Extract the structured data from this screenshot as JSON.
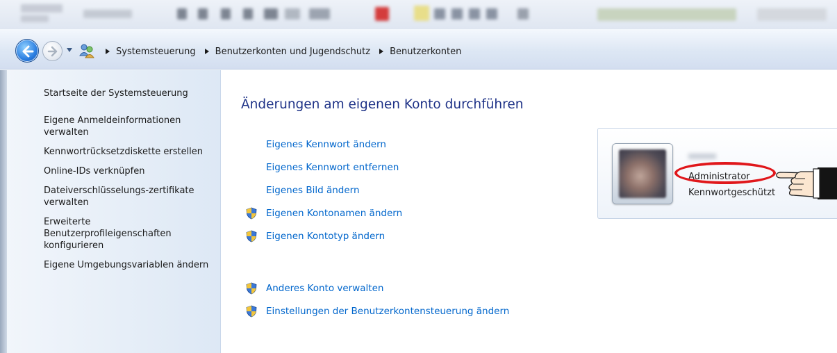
{
  "address_bar": {
    "breadcrumbs": [
      "Systemsteuerung",
      "Benutzerkonten und Jugendschutz",
      "Benutzerkonten"
    ]
  },
  "left_pane": {
    "tasks": [
      "Startseite der Systemsteuerung",
      "Eigene Anmeldeinformationen verwalten",
      "Kennwortrücksetzdiskette erstellen",
      "Online-IDs verknüpfen",
      "Dateiverschlüsselungs-zertifikate verwalten",
      "Erweiterte Benutzerprofileigenschaften konfigurieren",
      "Eigene Umgebungsvariablen ändern"
    ]
  },
  "main": {
    "title": "Änderungen am eigenen Konto durchführen",
    "links": [
      {
        "label": "Eigenes Kennwort ändern",
        "icon": "none"
      },
      {
        "label": "Eigenes Kennwort entfernen",
        "icon": "none"
      },
      {
        "label": "Eigenes Bild ändern",
        "icon": "none"
      },
      {
        "label": "Eigenen Kontonamen ändern",
        "icon": "uac-shield-icon"
      },
      {
        "label": "Eigenen Kontotyp ändern",
        "icon": "uac-shield-icon"
      }
    ],
    "links2": [
      {
        "label": "Anderes Konto verwalten",
        "icon": "uac-shield-icon"
      },
      {
        "label": "Einstellungen der Benutzerkontensteuerung ändern",
        "icon": "uac-shield-icon"
      }
    ]
  },
  "account_card": {
    "account_type": "Administrator",
    "status": "Kennwortgeschützt"
  },
  "colors": {
    "link": "#0066cc",
    "title": "#1e3287",
    "highlight": "#e0171b"
  }
}
